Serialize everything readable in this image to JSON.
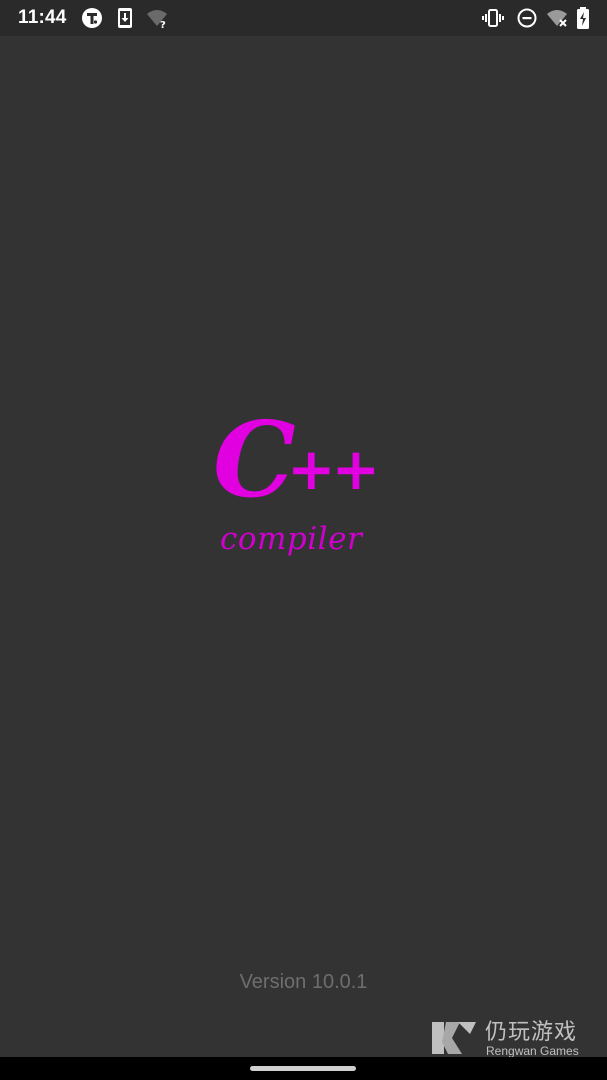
{
  "status_bar": {
    "time": "11:44",
    "left_icons": [
      "t-app-notification-icon",
      "download-notification-icon",
      "wifi-unknown-icon"
    ],
    "right_icons": [
      "vibrate-icon",
      "do-not-disturb-icon",
      "wifi-off-icon",
      "battery-charging-icon"
    ]
  },
  "splash": {
    "logo_main": "C",
    "logo_plus": "++",
    "logo_subtitle": "compiler",
    "logo_color": "#e000e0"
  },
  "footer": {
    "version": "Version 10.0.1"
  },
  "watermark": {
    "chinese": "仍玩游戏",
    "english": "Rengwan Games"
  },
  "colors": {
    "background": "#333333",
    "status_bar": "#2a2a2a",
    "version_text": "#6e6e6e"
  }
}
